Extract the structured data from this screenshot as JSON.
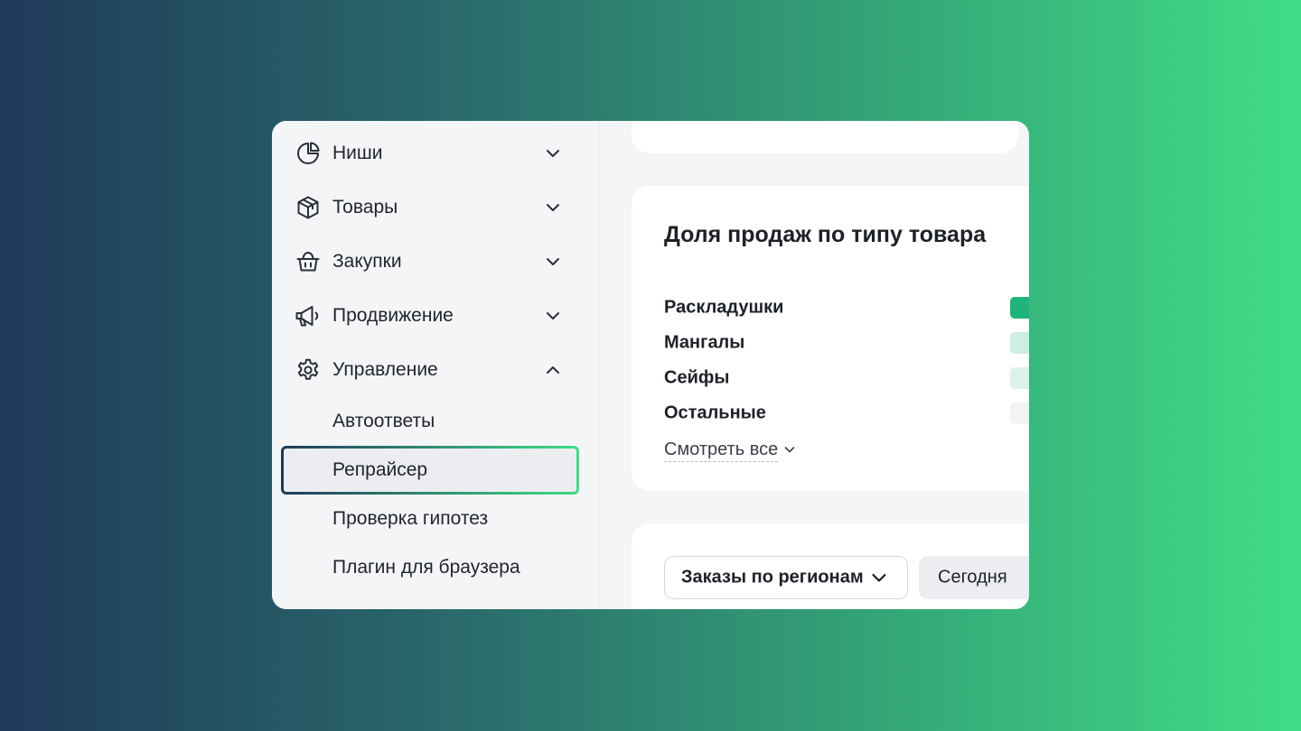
{
  "sidebar": {
    "items": [
      {
        "label": "Ниши",
        "icon": "pie-chart-icon",
        "expanded": false
      },
      {
        "label": "Товары",
        "icon": "box-icon",
        "expanded": false
      },
      {
        "label": "Закупки",
        "icon": "basket-icon",
        "expanded": false
      },
      {
        "label": "Продвижение",
        "icon": "megaphone-icon",
        "expanded": false
      },
      {
        "label": "Управление",
        "icon": "gear-icon",
        "expanded": true
      }
    ],
    "subitems": [
      {
        "label": "Автоответы",
        "active": false
      },
      {
        "label": "Репрайсер",
        "active": true
      },
      {
        "label": "Проверка гипотез",
        "active": false
      },
      {
        "label": "Плагин для браузера",
        "active": false
      }
    ]
  },
  "share_card": {
    "title": "Доля продаж по типу товара",
    "rows": [
      {
        "label": "Раскладушки",
        "color": "#1fb57a"
      },
      {
        "label": "Мангалы",
        "color": "#cdeee0"
      },
      {
        "label": "Сейфы",
        "color": "#dcf3e9"
      },
      {
        "label": "Остальные",
        "color": "#f2f4f3"
      }
    ],
    "see_all": "Смотреть все"
  },
  "orders_card": {
    "dropdown_label": "Заказы по регионам",
    "period_label": "Сегодня"
  },
  "colors": {
    "accent_green": "#1fb57a",
    "gradient_start": "#1f3a5a",
    "gradient_end": "#40dd86"
  }
}
